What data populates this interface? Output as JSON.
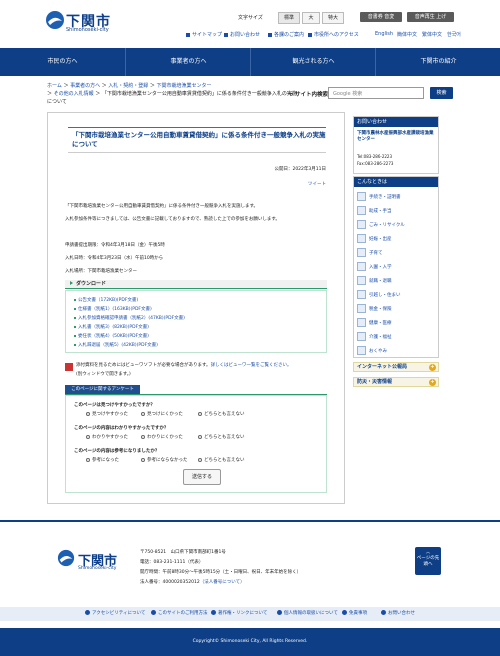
{
  "site": {
    "logo_text": "下関市",
    "logo_sub": "Shimonoseki-city"
  },
  "header": {
    "font_size_label": "文字サイズ",
    "font_sizes": [
      "標準",
      "大",
      "特大"
    ],
    "read_aloud": "音書券 音変",
    "voice": "音声再生 上げ",
    "util_links": [
      "サイトマップ",
      "お問い合わせ",
      "各課のご案内",
      "市役所へのアクセス"
    ],
    "languages": [
      "English",
      "簡体中文",
      "繁体中文",
      "한국어"
    ]
  },
  "nav": [
    "市民の方へ",
    "事業者の方へ",
    "観光される方へ",
    "下関市の紹介"
  ],
  "breadcrumb": {
    "items": [
      "ホーム",
      "事業者の方へ",
      "入札・契約・登録",
      "下関市栽培漁業センター",
      "その他の入札情報",
      "「下関市栽培漁業センター公用自動車賃貸借契約」に係る条件付き一般競争入札の実施について"
    ],
    "seps": [
      "＞",
      "＞",
      "＞",
      "＞",
      "＞"
    ]
  },
  "search": {
    "label": "サイト内検索",
    "placeholder": "Google 検索",
    "button": "検索"
  },
  "main": {
    "title": "「下関市栽培漁業センター公用自動車賃貸借契約」に係る条件付き一般競争入札の実施について",
    "pubdate": "公開日：2022年3月11日",
    "tweet": "ツイート",
    "p1": "「下関市栽培漁業センター公用自動車賃貸借契約」に係る条件付き一般競争入札を実施します。",
    "p2": "入札参加条件等につきましては、公告文書に記載しておりますので、熟読した上での参加をお願いします。",
    "p3": "申請書提出期限：令和4年3月18日（金）午後5時",
    "p4": "入札日時：令和4年3月23日（水）午前10時から",
    "p5": "入札場所：下関市栽培漁業センター",
    "download_label": "ダウンロード",
    "downloads": [
      "公告文書（172KB)(PDF文書)",
      "仕様書（別紙1）(163KB)(PDF文書)",
      "入札参加資格確認申請書（別紙2）(47KB)(PDF文書)",
      "入札書（別紙3）(82KB)(PDF文書)",
      "委任状（別紙4）(50KB)(PDF文書)",
      "入札辞退届（別紙5）(42KB)(PDF文書)"
    ],
    "pdf_note": "添付資料を見るためにはビューワソフトが必要な場合があります。",
    "pdf_link": "詳しくはビューワ一覧をご覧ください。",
    "pdf_note2": "(別ウィンドウで開きます。)"
  },
  "survey": {
    "tab": "このページに関するアンケート",
    "questions": [
      {
        "q": "このページは見つけやすかったですか？",
        "opts": [
          "見つけやすかった",
          "見つけにくかった",
          "どちらとも言えない"
        ]
      },
      {
        "q": "このページの内容はわかりやすかったですか？",
        "opts": [
          "わかりやすかった",
          "わかりにくかった",
          "どちらとも言えない"
        ]
      },
      {
        "q": "このページの内容は参考になりましたか？",
        "opts": [
          "参考になった",
          "参考にならなかった",
          "どちらとも言えない"
        ]
      }
    ],
    "send": "送信する"
  },
  "sidebar": {
    "contact_head": "お問い合わせ",
    "dept": "下関市農林水産振興部水産課栽培漁業センター",
    "tel": "Tel:083-286-2223",
    "fax": "Fax:083-286-2273",
    "konna_head": "こんなときは",
    "konna": [
      "手続き・証明書",
      "助成・手当",
      "ごみ・リサイクル",
      "妊娠・出産",
      "子育て",
      "入園・入学",
      "就職・退職",
      "引越し・住まい",
      "税金・保険",
      "健康・医療",
      "介護・福祉",
      "おくやみ"
    ],
    "bar1": "インターネット公報局",
    "bar2": "防災・災害情報"
  },
  "footer": {
    "logo_text": "下関市",
    "logo_sub": "Shimonoseki-city",
    "address": "〒750-8521　山口県下関市南部町1番1号",
    "tel": "電話：083-231-1111（代表）",
    "hours": "開庁時間：午前8時30分～午後5時15分（土・日曜日、祝日、年末年始を除く）",
    "corp": "法人番号：4000020352012",
    "corp_link": "（法人番号について）",
    "pagetop": "ページの先頭へ",
    "links": [
      "アクセシビリティについて",
      "このサイトのご利用方法",
      "著作権・リンクについて",
      "個人情報の取扱いについて",
      "免責事項",
      "お問い合わせ"
    ],
    "copyright": "Copyright© Shimonoseki City, All Rights Reserved."
  }
}
